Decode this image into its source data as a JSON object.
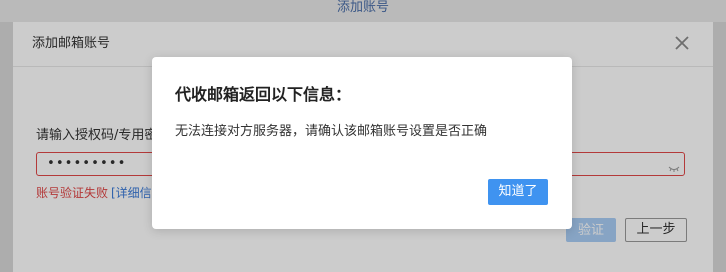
{
  "page": {
    "title": "添加账号"
  },
  "add_mailbox_dialog": {
    "title": "添加邮箱账号",
    "field_label": "请输入授权码/专用密码",
    "password_value": "•••••••••",
    "error_text": "账号验证失败",
    "detail_link": "[详细信息]",
    "verify_label": "验证",
    "back_label": "上一步",
    "close_icon": "close-icon",
    "visibility_icon": "eye-hidden-icon"
  },
  "alert_dialog": {
    "title": "代收邮箱返回以下信息：",
    "message": "无法连接对方服务器，请确认该邮箱账号设置是否正确",
    "ok_label": "知道了"
  },
  "colors": {
    "primary": "#3f93f0",
    "primary_disabled": "#a9cdf5",
    "error": "#e04848",
    "link": "#3a7ad8"
  }
}
